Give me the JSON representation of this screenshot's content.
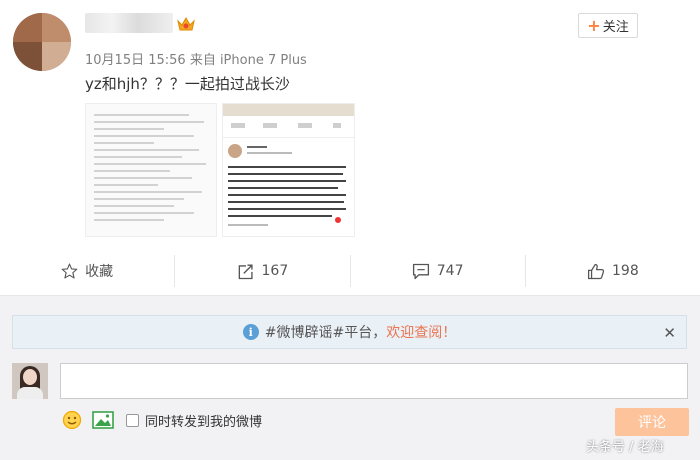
{
  "post": {
    "meta": "10月15日 15:56 来自 iPhone 7 Plus",
    "text": "yz和hjh？？？一起拍过战长沙",
    "follow_label": "关注"
  },
  "actions": {
    "favorite_label": "收藏",
    "repost_count": "167",
    "comment_count": "747",
    "like_count": "198"
  },
  "comment_box": {
    "notice_prefix": "#微博辟谣#平台，",
    "notice_highlight": "欢迎查阅！",
    "input_value": "",
    "sync_label": "同时转发到我的微博",
    "submit_label": "评论"
  },
  "watermark": "头条号 / 老海",
  "colors": {
    "accent_orange": "#ff8140",
    "submit_disabled": "#fdc39b",
    "notice_highlight": "#eb7350",
    "info_blue": "#5a9fd6"
  }
}
